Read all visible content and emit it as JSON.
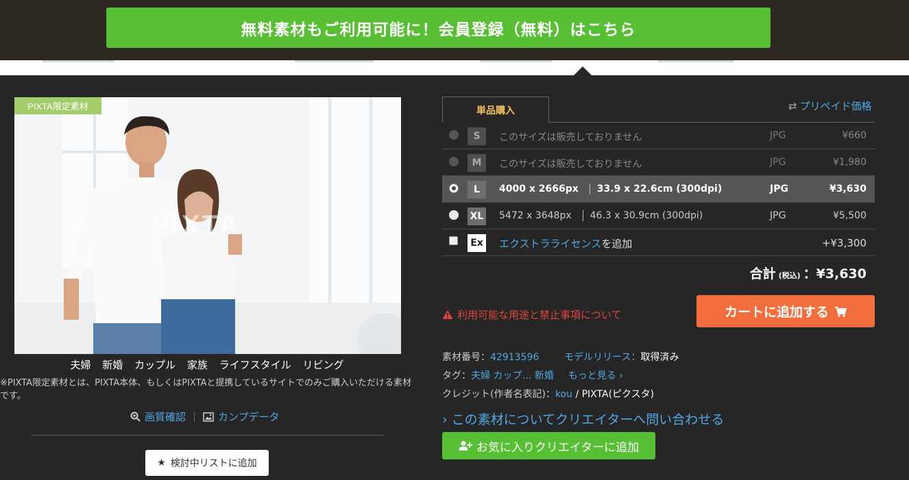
{
  "banner": {
    "signup_label": "無料素材もご利用可能に！会員登録（無料）はこちら"
  },
  "photo": {
    "badge": "PIXTA限定素材",
    "watermark": "PIXTA",
    "tags": [
      "夫婦",
      "新婚",
      "カップル",
      "家族",
      "ライフスタイル",
      "リビング"
    ],
    "note": "※PIXTA限定素材とは、PIXTA本体、もしくはPIXTAと提携しているサイトでのみご購入いただける素材です。",
    "quality_link": "画質確認",
    "comp_link": "カンプデータ",
    "watchlist_button": "検討中リストに追加"
  },
  "purchase": {
    "tab_label": "単品購入",
    "prepaid_link": "プリペイド価格",
    "sizes": [
      {
        "size": "S",
        "desc": "このサイズは販売しておりません",
        "dim": "",
        "format": "JPG",
        "price": "¥660",
        "state": "disabled"
      },
      {
        "size": "M",
        "desc": "このサイズは販売しておりません",
        "dim": "",
        "format": "JPG",
        "price": "¥1,980",
        "state": "disabled"
      },
      {
        "size": "L",
        "desc": "4000 x 2666px",
        "dim": "33.9 x 22.6cm (300dpi)",
        "format": "JPG",
        "price": "¥3,630",
        "state": "selected"
      },
      {
        "size": "XL",
        "desc": "5472 x 3648px",
        "dim": "46.3 x 30.9cm (300dpi)",
        "format": "JPG",
        "price": "¥5,500",
        "state": "available"
      }
    ],
    "extra": {
      "badge": "Ex",
      "link": "エクストラライセンス",
      "suffix": "を追加",
      "price": "+¥3,300"
    },
    "total_label": "合計",
    "total_tax": "(税込)",
    "total_value": "：¥3,630",
    "warning_link": "利用可能な用途と禁止事項について",
    "cart_button": "カートに追加する"
  },
  "meta": {
    "id_label": "素材番号：",
    "id_value": "42913596",
    "release_label": "モデルリリース：",
    "release_value": "取得済み",
    "tag_label": "タグ：",
    "tag_values": "夫婦 カップ… 新婚",
    "more_tags": "もっと見る ›",
    "credit_label": "クレジット(作者名表記)：",
    "credit_author": "kou",
    "credit_suffix": "/ PIXTA(ピクスタ)",
    "inquiry_link": "› この素材についてクリエイターへ問い合わせる",
    "favorite_button": "お気に入りクリエイターに追加"
  },
  "colors": {
    "green": "#56bf34",
    "orange": "#f26f3d",
    "link": "#4fa8e3",
    "warning": "#e0443c"
  }
}
